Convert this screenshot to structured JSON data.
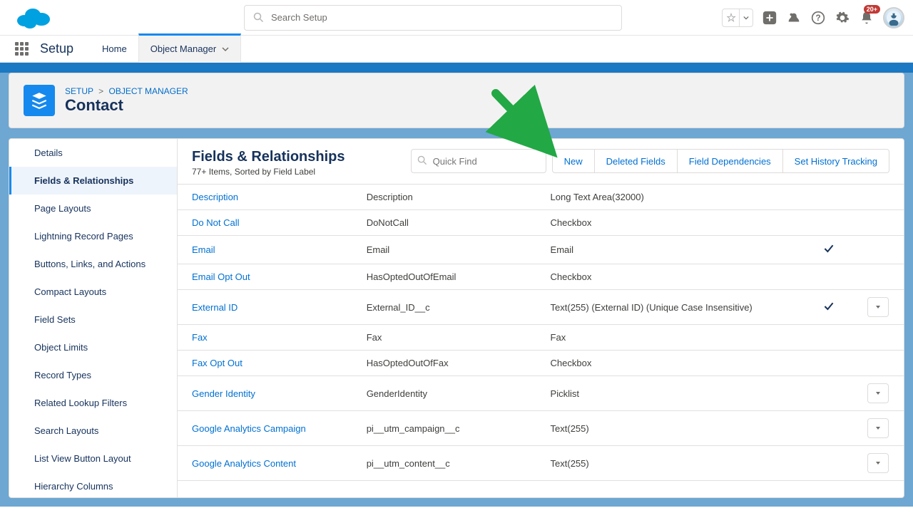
{
  "header": {
    "search_placeholder": "Search Setup",
    "notification_badge": "20+"
  },
  "nav": {
    "app_title": "Setup",
    "tabs": [
      "Home",
      "Object Manager"
    ]
  },
  "page": {
    "breadcrumb_setup": "SETUP",
    "breadcrumb_obj": "OBJECT MANAGER",
    "object_name": "Contact"
  },
  "sidebar": {
    "items": [
      "Details",
      "Fields & Relationships",
      "Page Layouts",
      "Lightning Record Pages",
      "Buttons, Links, and Actions",
      "Compact Layouts",
      "Field Sets",
      "Object Limits",
      "Record Types",
      "Related Lookup Filters",
      "Search Layouts",
      "List View Button Layout",
      "Hierarchy Columns"
    ],
    "active_index": 1
  },
  "content": {
    "title": "Fields & Relationships",
    "subtitle": "77+ Items, Sorted by Field Label",
    "quick_find_placeholder": "Quick Find",
    "actions": [
      "New",
      "Deleted Fields",
      "Field Dependencies",
      "Set History Tracking"
    ]
  },
  "rows": [
    {
      "label": "Description",
      "api": "Description",
      "type": "Long Text Area(32000)",
      "indexed": false,
      "menu": false
    },
    {
      "label": "Do Not Call",
      "api": "DoNotCall",
      "type": "Checkbox",
      "indexed": false,
      "menu": false
    },
    {
      "label": "Email",
      "api": "Email",
      "type": "Email",
      "indexed": true,
      "menu": false
    },
    {
      "label": "Email Opt Out",
      "api": "HasOptedOutOfEmail",
      "type": "Checkbox",
      "indexed": false,
      "menu": false
    },
    {
      "label": "External ID",
      "api": "External_ID__c",
      "type": "Text(255) (External ID) (Unique Case Insensitive)",
      "indexed": true,
      "menu": true
    },
    {
      "label": "Fax",
      "api": "Fax",
      "type": "Fax",
      "indexed": false,
      "menu": false
    },
    {
      "label": "Fax Opt Out",
      "api": "HasOptedOutOfFax",
      "type": "Checkbox",
      "indexed": false,
      "menu": false
    },
    {
      "label": "Gender Identity",
      "api": "GenderIdentity",
      "type": "Picklist",
      "indexed": false,
      "menu": true
    },
    {
      "label": "Google Analytics Campaign",
      "api": "pi__utm_campaign__c",
      "type": "Text(255)",
      "indexed": false,
      "menu": true
    },
    {
      "label": "Google Analytics Content",
      "api": "pi__utm_content__c",
      "type": "Text(255)",
      "indexed": false,
      "menu": true
    }
  ]
}
